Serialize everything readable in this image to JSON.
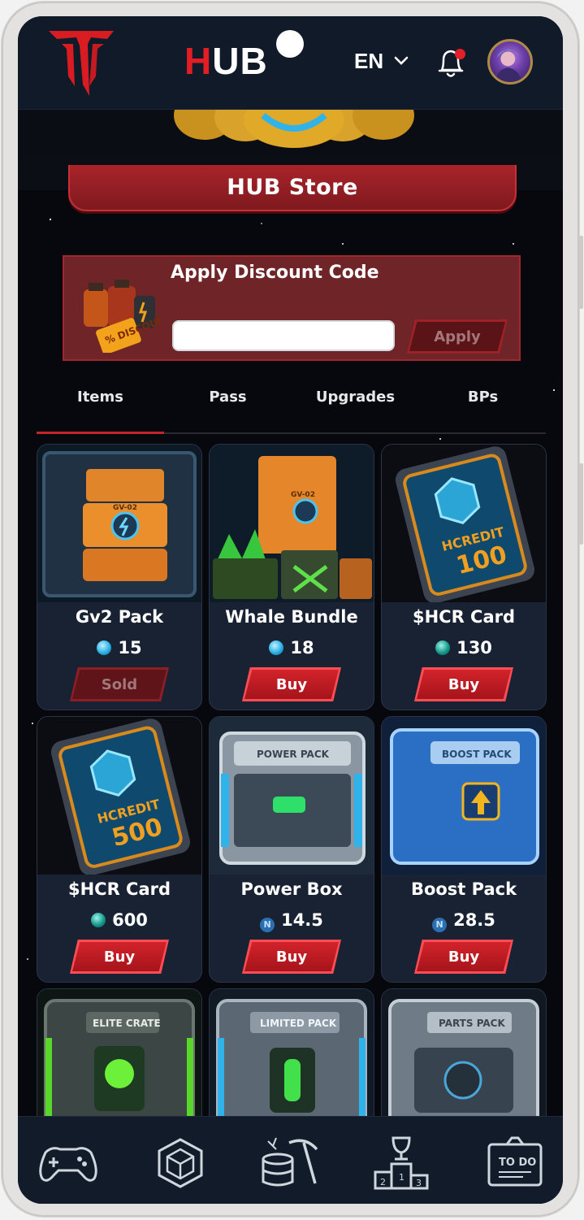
{
  "header": {
    "title_accent": "H",
    "title_rest": "UB",
    "language": "EN",
    "notification_unread": true
  },
  "banner": {
    "title": "HUB Store"
  },
  "discount": {
    "title": "Apply Discount Code",
    "input_value": "",
    "apply_label": "Apply"
  },
  "tabs": [
    {
      "label": "Items",
      "active": true
    },
    {
      "label": "Pass",
      "active": false
    },
    {
      "label": "Upgrades",
      "active": false
    },
    {
      "label": "BPs",
      "active": false
    }
  ],
  "items": [
    {
      "name": "Gv2 Pack",
      "price": "15",
      "currency_icon": "gem-icon",
      "button": "Sold",
      "sold": true
    },
    {
      "name": "Whale Bundle",
      "price": "18",
      "currency_icon": "gem-icon",
      "button": "Buy",
      "sold": false
    },
    {
      "name": "$HCR Card",
      "price": "130",
      "currency_icon": "hcr-coin-icon",
      "button": "Buy",
      "sold": false
    },
    {
      "name": "$HCR Card",
      "price": "600",
      "currency_icon": "hcr-coin-icon",
      "button": "Buy",
      "sold": false
    },
    {
      "name": "Power Box",
      "price": "14.5",
      "currency_icon": "n-coin-icon",
      "button": "Buy",
      "sold": false
    },
    {
      "name": "Boost Pack",
      "price": "28.5",
      "currency_icon": "n-coin-icon",
      "button": "Buy",
      "sold": false
    },
    {
      "name": "",
      "price": "",
      "label_on_image": "ELITE CRATE"
    },
    {
      "name": "",
      "price": "",
      "label_on_image": "LIMITED PACK"
    },
    {
      "name": "",
      "price": "",
      "label_on_image": "PARTS PACK"
    }
  ],
  "image_labels": {
    "gv2": "GV-02",
    "hcredit": "HCREDIT",
    "hcredit100": "100",
    "hcredit500": "500",
    "power": "POWER PACK",
    "boost": "BOOST PACK",
    "discount_tag": "% DISCOUNT",
    "todo": "TO DO"
  },
  "bottom_nav": [
    {
      "icon": "gamepad-icon"
    },
    {
      "icon": "cube-icon"
    },
    {
      "icon": "mining-icon"
    },
    {
      "icon": "podium-icon"
    },
    {
      "icon": "todo-board-icon"
    }
  ],
  "colors": {
    "accent": "#c4242b",
    "header_bg": "#111a28",
    "card_bg": "#192232"
  }
}
